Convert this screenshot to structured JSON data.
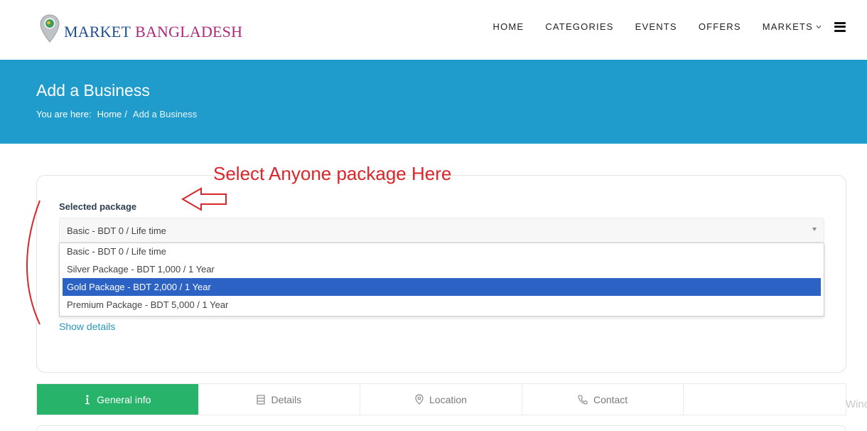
{
  "header": {
    "logo": {
      "word1": "MARKET",
      "word2": "BANGLADESH"
    },
    "nav": [
      {
        "label": "HOME"
      },
      {
        "label": "CATEGORIES"
      },
      {
        "label": "EVENTS"
      },
      {
        "label": "OFFERS"
      },
      {
        "label": "MARKETS",
        "has_dropdown": true
      }
    ],
    "icons": {
      "menu": "hamburger-icon",
      "markets_dropdown": "chevron-down-icon",
      "logo": "map-pin-icon"
    }
  },
  "hero": {
    "title": "Add a Business",
    "breadcrumb": {
      "prefix": "You are here:",
      "home": "Home",
      "separator": "/",
      "current": "Add a Business"
    },
    "background": "#209ccc"
  },
  "package_card": {
    "label": "Selected package",
    "selected_value": "Basic - BDT 0 / Life time",
    "options": [
      {
        "label": "Basic - BDT 0 / Life time"
      },
      {
        "label": "Silver Package - BDT 1,000 / 1 Year"
      },
      {
        "label": "Gold Package - BDT 2,000 / 1 Year",
        "highlighted": true
      },
      {
        "label": "Premium Package - BDT 5,000 / 1 Year"
      }
    ],
    "show_details": "Show details",
    "highlight_color": "#2c62c4"
  },
  "annotation": {
    "text": "Select Anyone package Here",
    "color": "#d9262b"
  },
  "tabs": [
    {
      "label": "General info",
      "icon": "info-icon",
      "active": true
    },
    {
      "label": "Details",
      "icon": "list-icon"
    },
    {
      "label": "Location",
      "icon": "map-pin-icon"
    },
    {
      "label": "Contact",
      "icon": "phone-icon"
    },
    {
      "label": ""
    }
  ],
  "tab_active_color": "#27b36a",
  "watermark": "Winc"
}
